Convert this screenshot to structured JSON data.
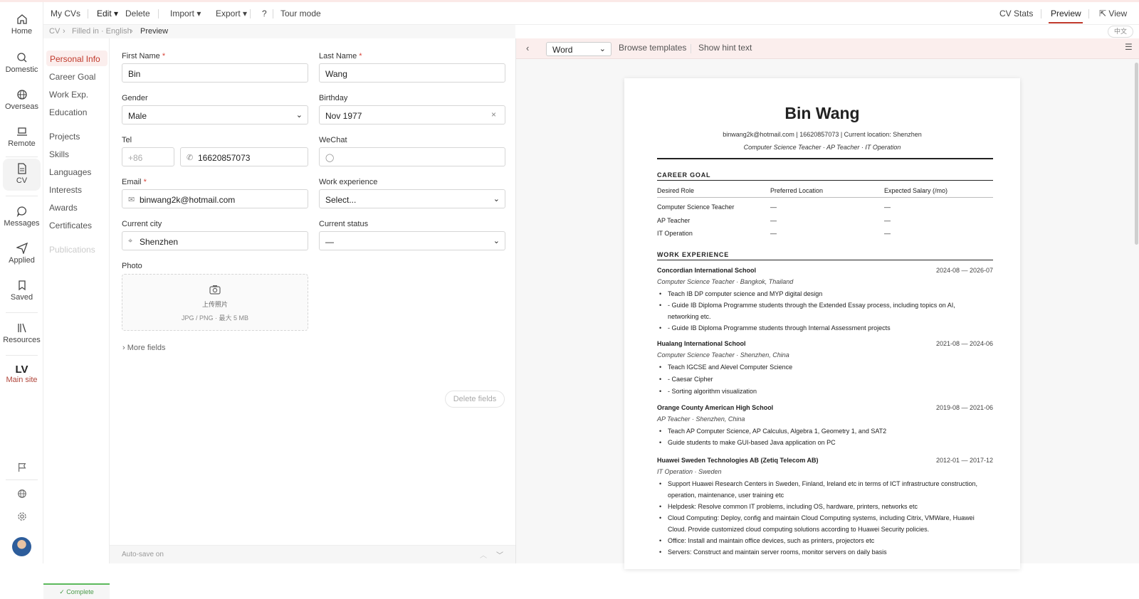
{
  "rail": {
    "home": "Home",
    "domestic": "Domestic",
    "overseas": "Overseas",
    "remote": "Remote",
    "cv": "CV",
    "messages": "Messages",
    "applied": "Applied",
    "saved": "Saved",
    "resources": "Resources",
    "logo": "LV",
    "main_site": "Main site"
  },
  "topbar": {
    "my_cvs": "My CVs",
    "edit": "Edit ▾",
    "delete": "Delete",
    "import": "Import ▾",
    "export": "Export ▾",
    "help": "?",
    "tour": "Tour mode",
    "cv_stats": "CV Stats",
    "preview": "Preview",
    "view": "View"
  },
  "breadcrumb": {
    "cv": "CV",
    "filled": "Filled in · English",
    "preview": "Preview"
  },
  "lang_badge": "中文",
  "sections": {
    "personal": "Personal Info",
    "career": "Career Goal",
    "work": "Work Exp.",
    "education": "Education",
    "projects": "Projects",
    "skills": "Skills",
    "languages": "Languages",
    "interests": "Interests",
    "awards": "Awards",
    "certificates": "Certificates",
    "publications": "Publications",
    "complete": "✓ Complete"
  },
  "form": {
    "first_name_label": "First Name",
    "first_name": "Bin",
    "last_name_label": "Last Name",
    "last_name": "Wang",
    "gender_label": "Gender",
    "gender": "Male",
    "birthday_label": "Birthday",
    "birthday": "Nov 1977",
    "tel_label": "Tel",
    "tel_code_placeholder": "+86",
    "tel": "16620857073",
    "wechat_label": "WeChat",
    "email_label": "Email",
    "email": "binwang2k@hotmail.com",
    "work_exp_label": "Work experience",
    "work_exp": "Select...",
    "city_label": "Current city",
    "city": "Shenzhen",
    "status_label": "Current status",
    "status": "—",
    "photo_label": "Photo",
    "photo_upload": "上传照片",
    "photo_hint": "JPG / PNG · 最大 5 MB",
    "more_fields": "More fields",
    "delete_fields": "Delete fields",
    "autosave": "Auto-save on",
    "required_mark": "*"
  },
  "preview_toolbar": {
    "format": "Word",
    "browse": "Browse templates",
    "hint": "Show hint text"
  },
  "cv": {
    "name": "Bin Wang",
    "contact": "binwang2k@hotmail.com | 16620857073 | Current location: Shenzhen",
    "roles": "Computer Science Teacher · AP Teacher · IT Operation",
    "career_goal": {
      "heading": "CAREER GOAL",
      "columns": [
        "Desired Role",
        "Preferred Location",
        "Expected Salary (/mo)"
      ],
      "rows": [
        [
          "Computer Science Teacher",
          "—",
          "—"
        ],
        [
          "AP Teacher",
          "—",
          "—"
        ],
        [
          "IT Operation",
          "—",
          "—"
        ]
      ]
    },
    "work": {
      "heading": "WORK EXPERIENCE",
      "jobs": [
        {
          "company": "Concordian International School",
          "dates": "2024-08 — 2026-07",
          "role": "Computer Science Teacher · Bangkok, Thailand",
          "bullets": [
            "Teach IB DP computer science and MYP digital design",
            "- Guide IB Diploma Programme students through the Extended Essay process, including topics on AI, networking etc.",
            "- Guide IB Diploma Programme students through Internal Assessment projects"
          ]
        },
        {
          "company": "Hualang International School",
          "dates": "2021-08 — 2024-06",
          "role": "Computer Science Teacher · Shenzhen, China",
          "bullets": [
            "Teach IGCSE and Alevel Computer Science",
            "- Caesar Cipher",
            "- Sorting algorithm visualization"
          ]
        },
        {
          "company": "Orange County American High School",
          "dates": "2019-08 — 2021-06",
          "role": "AP Teacher · Shenzhen, China",
          "bullets": [
            "Teach AP Computer Science, AP Calculus, Algebra 1, Geometry 1, and SAT2",
            "Guide students to make GUI-based Java application on PC"
          ]
        },
        {
          "company": "Huawei Sweden Technologies AB (Zetiq Telecom AB)",
          "dates": "2012-01 — 2017-12",
          "role": "IT Operation · Sweden",
          "bullets": [
            "Support Huawei Research Centers in Sweden, Finland, Ireland etc in terms of ICT infrastructure construction, operation, maintenance, user training etc",
            "Helpdesk: Resolve common IT problems, including OS, hardware, printers, networks etc",
            "Cloud Computing: Deploy, config and maintain Cloud Computing systems, including Citrix, VMWare, Huawei Cloud. Provide customized cloud computing solutions according to Huawei Security policies.",
            "Office: Install and maintain office devices, such as printers, projectors etc",
            "Servers: Construct and maintain server rooms, monitor servers on daily basis"
          ]
        }
      ]
    }
  },
  "colors": {
    "accent": "#c0392b",
    "highlight_bg": "#fbeeed",
    "complete": "#5cb85c"
  }
}
